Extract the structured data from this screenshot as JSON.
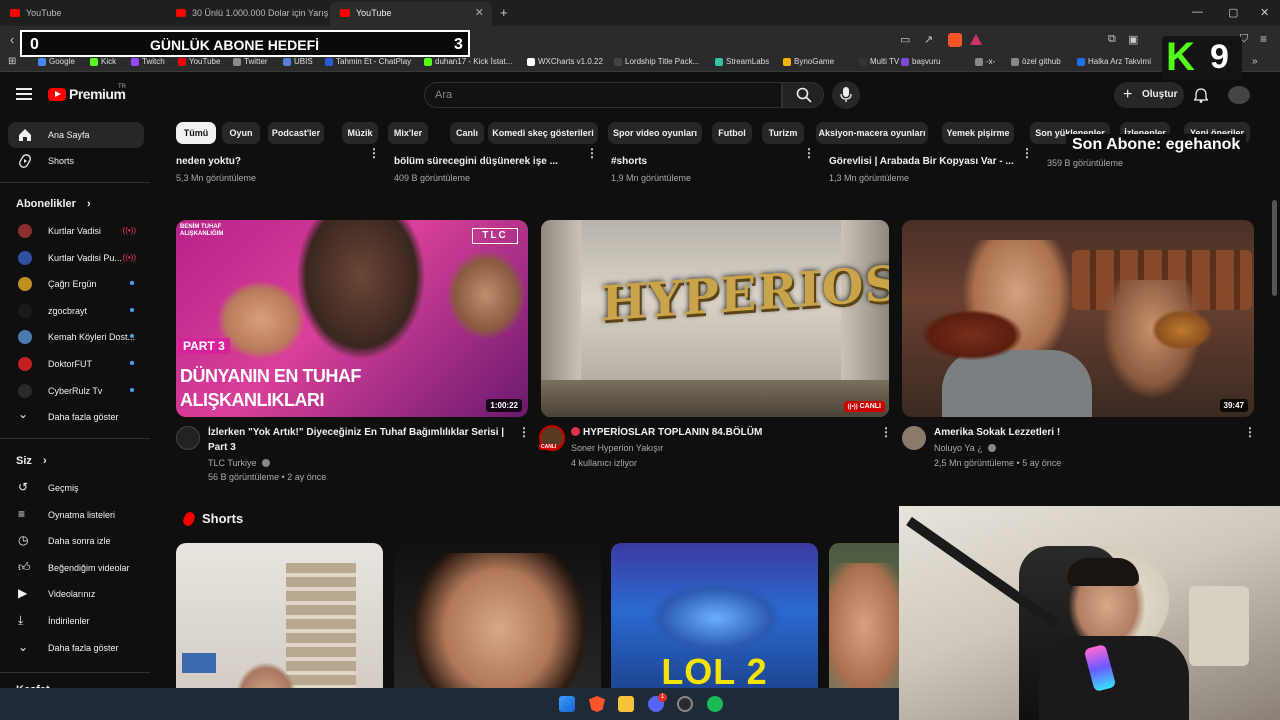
{
  "browser": {
    "tabs": [
      {
        "title": "YouTube"
      },
      {
        "title": "30 Ünlü 1.000.000 Dolar için Yarışıyor"
      },
      {
        "title": "YouTube",
        "active": true
      }
    ],
    "new_tab": "+",
    "bookmarks": [
      {
        "label": "Google",
        "color": "#4285f4"
      },
      {
        "label": "Kick",
        "color": "#53fc18"
      },
      {
        "label": "Twitch",
        "color": "#9146ff"
      },
      {
        "label": "YouTube",
        "color": "#ff0000"
      },
      {
        "label": "Twitter",
        "color": "#888888"
      },
      {
        "label": "UBIS",
        "color": "#5a7bd6"
      },
      {
        "label": "Tahmin Et - ChatPlay",
        "color": "#2a5bd7"
      },
      {
        "label": "duhan17 - Kick İstat...",
        "color": "#53fc18"
      },
      {
        "label": "WXCharts v1.0.22",
        "color": "#ffffff"
      },
      {
        "label": "Lordship Title Pack...",
        "color": "#444444"
      },
      {
        "label": "StreamLabs",
        "color": "#31c3a2"
      },
      {
        "label": "BynoGame",
        "color": "#f7b500"
      },
      {
        "label": "Multi TV",
        "color": "#333333"
      },
      {
        "label": "başvuru",
        "color": "#7b4bd6"
      },
      {
        "label": "-x-",
        "color": "#888888"
      },
      {
        "label": "özel github",
        "color": "#888888"
      },
      {
        "label": "Halka Arz Takvimi",
        "color": "#1a73e8"
      }
    ]
  },
  "overlay": {
    "goal_left": "0",
    "goal_title": "GÜNLÜK ABONE HEDEFİ",
    "goal_right": "3",
    "kick_letter": "K",
    "kick_count": "9",
    "last_sub": "Son Abone: egehanok"
  },
  "youtube": {
    "logo_text": "Premium",
    "logo_sup": "TR",
    "search_placeholder": "Ara",
    "create_label": "Oluştur",
    "chips": [
      "Tümü",
      "Oyun",
      "Podcast'ler",
      "Müzik",
      "Mix'ler",
      "Canlı",
      "Komedi skeç gösterileri",
      "Spor video oyunları",
      "Futbol",
      "Turizm",
      "Aksiyon-macera oyunları",
      "Yemek pişirme",
      "Son yüklenenler",
      "İzlenenler",
      "Yeni öneriler"
    ],
    "sidebar": {
      "main": [
        {
          "label": "Ana Sayfa",
          "icon": "home-icon",
          "selected": true
        },
        {
          "label": "Shorts",
          "icon": "shorts-icon"
        }
      ],
      "subs_header": "Abonelikler",
      "subs": [
        {
          "label": "Kurtlar Vadisi",
          "color": "#8a3030",
          "live": true
        },
        {
          "label": "Kurtlar Vadisi Pu...",
          "color": "#3050a0",
          "live": true
        },
        {
          "label": "Çağrı Ergün",
          "color": "#c09020"
        },
        {
          "label": "zgocbrayt",
          "color": "#1a1a1a"
        },
        {
          "label": "Kemah Köyleri Dost...",
          "color": "#4a7ab0"
        },
        {
          "label": "DoktorFUT",
          "color": "#c02020"
        },
        {
          "label": "CyberRulz Tv",
          "color": "#2a2a2a"
        }
      ],
      "more_subs": "Daha fazla göster",
      "you_header": "Siz",
      "you": [
        {
          "label": "Geçmiş",
          "icon": "history-icon"
        },
        {
          "label": "Oynatma listeleri",
          "icon": "playlist-icon"
        },
        {
          "label": "Daha sonra izle",
          "icon": "watch-later-icon"
        },
        {
          "label": "Beğendiğim videolar",
          "icon": "like-icon"
        },
        {
          "label": "Videolarınız",
          "icon": "your-videos-icon"
        },
        {
          "label": "İndirilenler",
          "icon": "download-icon"
        },
        {
          "label": "Daha fazla göster",
          "icon": "chevron-down-icon"
        }
      ],
      "explore_header": "Keşfet"
    },
    "top_row": [
      {
        "title": "neden yoktu?",
        "views": "5,3 Mn görüntüleme"
      },
      {
        "title": "bölüm sürecegini düşünerek işe ...",
        "views": "409 B görüntüleme"
      },
      {
        "title": "#shorts",
        "views": "1,9 Mn görüntüleme"
      },
      {
        "title": "Görevlisi | Arabada Bir Kopyası Var - ...",
        "views": "1,3 Mn görüntüleme"
      },
      {
        "title": "",
        "views": "359 B görüntüleme"
      }
    ],
    "videos": [
      {
        "title": "İzlerken \"Yok Artık!\" Diyeceğiniz En Tuhaf Bağımlılıklar Serisi | Part 3",
        "channel": "TLC Turkiye",
        "stats": "56 B görüntüleme • 2 ay önce",
        "duration": "1:00:22",
        "thumb_top": "BENİM TUHAF ALIŞKANLIĞIM",
        "thumb_part": "PART 3",
        "thumb_line1": "DÜNYANIN EN TUHAF",
        "thumb_line2": "ALIŞKANLIKLARI",
        "thumb_brand": "TLC"
      },
      {
        "title": "HYPERİOSLAR TOPLANIN  84.BÖLÜM",
        "channel": "Soner Hyperion Yakışır",
        "stats": "4 kullanıcı izliyor",
        "badge": "CANLI",
        "avatar_badge": "CANLI",
        "thumb_word": "HYPERIOS"
      },
      {
        "title": "Amerika Sokak Lezzetleri !",
        "channel": "Noluyo Ya ¿",
        "stats": "2,5 Mn görüntüleme • 5 ay önce",
        "duration": "39:47"
      }
    ],
    "shorts_title": "Shorts",
    "shorts": [
      {
        "text": ""
      },
      {
        "text": ""
      },
      {
        "text": "LOL 2"
      },
      {
        "text": ""
      }
    ]
  },
  "taskbar": {
    "discord_badge": "1"
  }
}
